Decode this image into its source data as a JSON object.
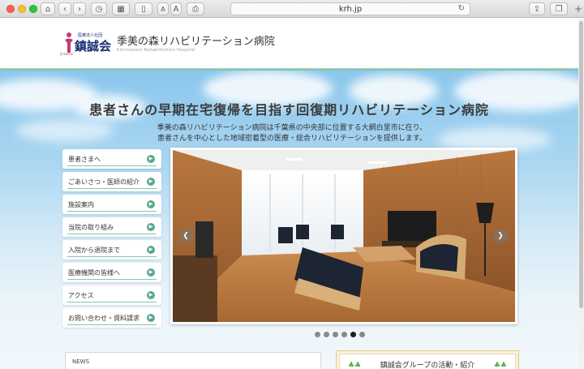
{
  "browser": {
    "url": "krh.jp",
    "font_small_label": "A",
    "font_large_label": "A"
  },
  "header": {
    "logo_small": "医療法人社団",
    "logo_name": "鎮誠会",
    "logo_tiny": "jinseikai",
    "hospital_name": "季美の森リハビリテーション病院",
    "hospital_name_en": "Kiminomori Rehabilitation Hospital"
  },
  "hero": {
    "title": "患者さんの早期在宅復帰を目指す回復期リハビリテーション病院",
    "desc_line1": "季美の森リハビリテーション病院は千葉県の中央部に位置する大網白里市に在り、",
    "desc_line2": "患者さんを中心とした地域密着型の医療・総合リハビリテーションを提供します。"
  },
  "nav": {
    "items": [
      {
        "label": "患者さまへ"
      },
      {
        "label": "ごあいさつ・医師の紹介"
      },
      {
        "label": "施設案内"
      },
      {
        "label": "当院の取り組み"
      },
      {
        "label": "入院から退院まで"
      },
      {
        "label": "医療機関の皆様へ"
      },
      {
        "label": "アクセス"
      },
      {
        "label": "お問い合わせ・資料請求"
      }
    ]
  },
  "slideshow": {
    "total_dots": 6,
    "active_dot": 5
  },
  "news": {
    "title": "NEWS"
  },
  "group_box": {
    "title": "鎮誠会グループの活動・紹介"
  },
  "colors": {
    "accent_green": "#5aa890",
    "brand_navy": "#1b2e75",
    "brand_pink": "#c73a77"
  }
}
